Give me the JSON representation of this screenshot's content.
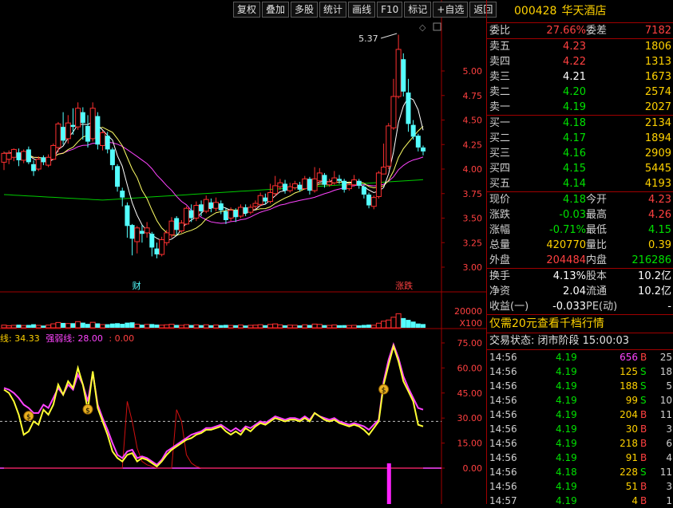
{
  "toolbar": {
    "buttons": [
      "复权",
      "叠加",
      "多股",
      "统计",
      "画线",
      "F10",
      "标记",
      "+自选",
      "返回"
    ]
  },
  "chart": {
    "price_axis": [
      "5.00",
      "4.75",
      "4.50",
      "4.25",
      "4.00",
      "3.75",
      "3.50",
      "3.25",
      "3.00"
    ],
    "vol_axis": [
      "20000",
      "X100"
    ],
    "ind_axis": [
      "75.00",
      "60.00",
      "45.00",
      "30.00",
      "15.00",
      "0.00"
    ],
    "high_label": "5.37",
    "marker_cai": "财",
    "marker_zhangdie": "涨跌",
    "indicator_name_1": "线: 34.33",
    "indicator_name_2": "强弱线: 28.00",
    "indicator_name_3": ": 0.00",
    "colors": {
      "up": "#ff3030",
      "down": "#54ffff",
      "ma5": "#ffffff",
      "ma10": "#ffff66",
      "ma20": "#ff44ff",
      "ma60": "#00cc00"
    },
    "candles": [
      [
        4.07,
        4.16,
        4.18,
        3.99
      ],
      [
        4.1,
        4.16,
        4.19,
        4.05
      ],
      [
        4.12,
        4.2,
        4.21,
        4.08
      ],
      [
        4.17,
        4.09,
        4.21,
        4.03
      ],
      [
        4.09,
        4.18,
        4.2,
        4.06
      ],
      [
        4.2,
        4.07,
        4.23,
        4.05
      ],
      [
        4.05,
        3.98,
        4.09,
        3.93
      ],
      [
        4.0,
        4.1,
        4.13,
        3.98
      ],
      [
        4.12,
        4.07,
        4.14,
        4.04
      ],
      [
        4.04,
        4.12,
        4.15,
        4.02
      ],
      [
        4.1,
        4.24,
        4.26,
        4.09
      ],
      [
        4.22,
        4.46,
        4.48,
        4.17
      ],
      [
        4.43,
        4.29,
        4.58,
        4.25
      ],
      [
        4.31,
        4.47,
        4.55,
        4.26
      ],
      [
        4.45,
        4.43,
        4.62,
        4.35
      ],
      [
        4.43,
        4.62,
        4.68,
        4.4
      ],
      [
        4.58,
        4.47,
        4.63,
        4.3
      ],
      [
        4.44,
        4.28,
        4.55,
        4.22
      ],
      [
        4.31,
        4.62,
        4.68,
        4.28
      ],
      [
        4.54,
        4.25,
        4.58,
        4.2
      ],
      [
        4.24,
        4.37,
        4.39,
        4.19
      ],
      [
        4.34,
        4.2,
        4.38,
        4.16
      ],
      [
        4.2,
        4.04,
        4.22,
        3.99
      ],
      [
        4.03,
        3.82,
        4.05,
        3.77
      ],
      [
        3.78,
        3.71,
        3.81,
        3.62
      ],
      [
        3.63,
        3.42,
        3.66,
        3.3
      ],
      [
        3.43,
        3.29,
        3.44,
        3.12
      ],
      [
        3.26,
        3.4,
        3.42,
        3.14
      ],
      [
        3.37,
        3.34,
        3.43,
        3.25
      ],
      [
        3.35,
        3.4,
        3.46,
        3.3
      ],
      [
        3.34,
        3.2,
        3.36,
        3.11
      ],
      [
        3.19,
        3.13,
        3.25,
        3.09
      ],
      [
        3.13,
        3.28,
        3.31,
        3.11
      ],
      [
        3.25,
        3.35,
        3.38,
        3.22
      ],
      [
        3.33,
        3.47,
        3.51,
        3.3
      ],
      [
        3.5,
        3.38,
        3.52,
        3.33
      ],
      [
        3.37,
        3.45,
        3.48,
        3.35
      ],
      [
        3.44,
        3.6,
        3.62,
        3.43
      ],
      [
        3.58,
        3.5,
        3.64,
        3.46
      ],
      [
        3.5,
        3.63,
        3.67,
        3.47
      ],
      [
        3.64,
        3.57,
        3.68,
        3.52
      ],
      [
        3.57,
        3.69,
        3.73,
        3.55
      ],
      [
        3.66,
        3.6,
        3.7,
        3.56
      ],
      [
        3.6,
        3.66,
        3.71,
        3.57
      ],
      [
        3.65,
        3.58,
        3.68,
        3.54
      ],
      [
        3.57,
        3.48,
        3.6,
        3.44
      ],
      [
        3.5,
        3.58,
        3.61,
        3.47
      ],
      [
        3.58,
        3.51,
        3.6,
        3.46
      ],
      [
        3.52,
        3.61,
        3.64,
        3.5
      ],
      [
        3.61,
        3.55,
        3.64,
        3.52
      ],
      [
        3.56,
        3.61,
        3.64,
        3.54
      ],
      [
        3.62,
        3.65,
        3.68,
        3.59
      ],
      [
        3.64,
        3.73,
        3.76,
        3.62
      ],
      [
        3.71,
        3.67,
        3.75,
        3.64
      ],
      [
        3.67,
        3.76,
        3.85,
        3.65
      ],
      [
        3.75,
        3.83,
        3.93,
        3.72
      ],
      [
        3.82,
        3.86,
        3.9,
        3.79
      ],
      [
        3.85,
        3.78,
        3.89,
        3.75
      ],
      [
        3.78,
        3.82,
        3.86,
        3.76
      ],
      [
        3.81,
        3.85,
        3.88,
        3.79
      ],
      [
        3.84,
        3.79,
        3.87,
        3.77
      ],
      [
        3.8,
        3.9,
        3.93,
        3.79
      ],
      [
        3.9,
        3.78,
        3.92,
        3.74
      ],
      [
        3.78,
        3.9,
        4.02,
        3.76
      ],
      [
        3.88,
        3.96,
        4.01,
        3.86
      ],
      [
        3.94,
        3.84,
        3.96,
        3.81
      ],
      [
        3.84,
        3.87,
        3.9,
        3.82
      ],
      [
        3.86,
        3.91,
        3.98,
        3.84
      ],
      [
        3.9,
        3.88,
        3.94,
        3.85
      ],
      [
        3.88,
        3.79,
        3.9,
        3.76
      ],
      [
        3.8,
        3.84,
        3.86,
        3.78
      ],
      [
        3.84,
        3.89,
        3.94,
        3.82
      ],
      [
        3.88,
        3.83,
        3.9,
        3.8
      ],
      [
        3.82,
        3.74,
        3.84,
        3.7
      ],
      [
        3.74,
        3.63,
        3.76,
        3.6
      ],
      [
        3.62,
        3.71,
        3.73,
        3.59
      ],
      [
        3.72,
        3.96,
        3.98,
        3.7
      ],
      [
        3.95,
        4.02,
        4.26,
        3.95
      ],
      [
        4.03,
        4.44,
        4.47,
        4.0
      ],
      [
        4.42,
        4.74,
        4.92,
        4.4
      ],
      [
        4.74,
        5.22,
        5.37,
        4.72
      ],
      [
        5.12,
        4.79,
        5.18,
        4.74
      ],
      [
        4.78,
        4.46,
        4.92,
        4.38
      ],
      [
        4.45,
        4.33,
        4.5,
        4.3
      ],
      [
        4.34,
        4.22,
        4.36,
        4.18
      ],
      [
        4.22,
        4.18,
        4.24,
        4.14
      ]
    ],
    "volumes": [
      30,
      24,
      28,
      35,
      26,
      32,
      40,
      27,
      25,
      30,
      45,
      60,
      55,
      48,
      52,
      70,
      58,
      44,
      62,
      50,
      36,
      40,
      48,
      52,
      45,
      58,
      62,
      40,
      35,
      38,
      42,
      36,
      30,
      34,
      40,
      32,
      28,
      35,
      31,
      33,
      30,
      34,
      29,
      31,
      30,
      33,
      27,
      29,
      31,
      26,
      28,
      30,
      35,
      29,
      38,
      44,
      33,
      28,
      30,
      29,
      27,
      34,
      31,
      42,
      38,
      30,
      27,
      32,
      29,
      30,
      26,
      28,
      27,
      32,
      36,
      29,
      52,
      75,
      88,
      120,
      160,
      110,
      90,
      70,
      48,
      42
    ],
    "ind_yellow": [
      47,
      45,
      40,
      32,
      20,
      22,
      28,
      26,
      35,
      32,
      38,
      50,
      44,
      52,
      48,
      60,
      50,
      35,
      58,
      36,
      28,
      20,
      10,
      6,
      4,
      8,
      9,
      4,
      6,
      5,
      3,
      1,
      4,
      8,
      11,
      13,
      15,
      17,
      18,
      20,
      21,
      23,
      23,
      24,
      25,
      22,
      20,
      22,
      20,
      24,
      22,
      25,
      27,
      26,
      28,
      30,
      29,
      28,
      29,
      29,
      28,
      30,
      28,
      33,
      31,
      29,
      28,
      29,
      27,
      26,
      25,
      26,
      25,
      23,
      20,
      24,
      28,
      50,
      62,
      73,
      64,
      52,
      46,
      40,
      26,
      25
    ],
    "ind_magenta": [
      48,
      47,
      45,
      42,
      38,
      36,
      33,
      33,
      38,
      36,
      42,
      48,
      44,
      50,
      47,
      56,
      50,
      40,
      57,
      38,
      30,
      23,
      15,
      8,
      6,
      10,
      11,
      6,
      7,
      6,
      4,
      2,
      5,
      10,
      12,
      14,
      16,
      18,
      20,
      21,
      22,
      24,
      24,
      25,
      26,
      24,
      22,
      24,
      22,
      25,
      24,
      26,
      28,
      27,
      29,
      31,
      30,
      29,
      30,
      30,
      29,
      31,
      29,
      33,
      31,
      30,
      29,
      30,
      28,
      27,
      26,
      27,
      26,
      25,
      23,
      26,
      29,
      52,
      65,
      74,
      66,
      55,
      48,
      42,
      36,
      35
    ],
    "ind_red": [
      0,
      0,
      0,
      0,
      0,
      0,
      0,
      0,
      0,
      0,
      0,
      0,
      0,
      0,
      0,
      0,
      0,
      0,
      0,
      0,
      0,
      0,
      0,
      0,
      0,
      40,
      28,
      12,
      4,
      2,
      1,
      0,
      0,
      0,
      0,
      35,
      28,
      8,
      3,
      1,
      0,
      0,
      0,
      0,
      0,
      0,
      0,
      0,
      0,
      0,
      0,
      0,
      0,
      0,
      0,
      0,
      0,
      0,
      0,
      0,
      0,
      0,
      0,
      0,
      0,
      0,
      0,
      0,
      0,
      0,
      0,
      0,
      0,
      0,
      0,
      0,
      0,
      0,
      0,
      0,
      0,
      0,
      0,
      0,
      0,
      0
    ]
  },
  "quote": {
    "code": "000428",
    "name": "华天酒店",
    "weibi_label": "委比",
    "weibi_value": "27.66%",
    "weicha_label": "委差",
    "weicha_value": "7182",
    "sells": [
      {
        "label": "卖五",
        "price": "4.23",
        "vol": "1806",
        "color": "red"
      },
      {
        "label": "卖四",
        "price": "4.22",
        "vol": "1313",
        "color": "red"
      },
      {
        "label": "卖三",
        "price": "4.21",
        "vol": "1673",
        "color": "white"
      },
      {
        "label": "卖二",
        "price": "4.20",
        "vol": "2574",
        "color": "green"
      },
      {
        "label": "卖一",
        "price": "4.19",
        "vol": "2027",
        "color": "green"
      }
    ],
    "buys": [
      {
        "label": "买一",
        "price": "4.18",
        "vol": "2134",
        "color": "green"
      },
      {
        "label": "买二",
        "price": "4.17",
        "vol": "1894",
        "color": "green"
      },
      {
        "label": "买三",
        "price": "4.16",
        "vol": "2909",
        "color": "green"
      },
      {
        "label": "买四",
        "price": "4.15",
        "vol": "5445",
        "color": "green"
      },
      {
        "label": "买五",
        "price": "4.14",
        "vol": "4193",
        "color": "green"
      }
    ],
    "stats": [
      {
        "l1": "现价",
        "v1": "4.18",
        "c1": "green",
        "l2": "今开",
        "v2": "4.23",
        "c2": "red"
      },
      {
        "l1": "涨跌",
        "v1": "-0.03",
        "c1": "green",
        "l2": "最高",
        "v2": "4.26",
        "c2": "red"
      },
      {
        "l1": "涨幅",
        "v1": "-0.71%",
        "c1": "green",
        "l2": "最低",
        "v2": "4.15",
        "c2": "green"
      },
      {
        "l1": "总量",
        "v1": "420770",
        "c1": "yellow",
        "l2": "量比",
        "v2": "0.39",
        "c2": "yellow"
      },
      {
        "l1": "外盘",
        "v1": "204484",
        "c1": "red",
        "l2": "内盘",
        "v2": "216286",
        "c2": "green"
      }
    ],
    "fund": [
      {
        "l1": "换手",
        "v1": "4.13%",
        "l2": "股本",
        "v2": "10.2亿"
      },
      {
        "l1": "净资",
        "v1": "2.04",
        "l2": "流通",
        "v2": "10.2亿"
      },
      {
        "l1": "收益(一)",
        "v1": "-0.033",
        "l2": "PE(动)",
        "v2": "-"
      }
    ],
    "notice": "仅需20元查看千档行情",
    "trade_state": "交易状态: 闭市阶段 15:00:03",
    "ticks": [
      {
        "t": "14:56",
        "p": "4.19",
        "v": "656",
        "vc": "#ff44ff",
        "f": "B",
        "n": "25"
      },
      {
        "t": "14:56",
        "p": "4.19",
        "v": "125",
        "vc": "#ffd200",
        "f": "S",
        "n": "18"
      },
      {
        "t": "14:56",
        "p": "4.19",
        "v": "188",
        "vc": "#ffd200",
        "f": "S",
        "n": "5"
      },
      {
        "t": "14:56",
        "p": "4.19",
        "v": "99",
        "vc": "#ffd200",
        "f": "S",
        "n": "10"
      },
      {
        "t": "14:56",
        "p": "4.19",
        "v": "204",
        "vc": "#ffd200",
        "f": "B",
        "n": "11"
      },
      {
        "t": "14:56",
        "p": "4.19",
        "v": "30",
        "vc": "#ffd200",
        "f": "B",
        "n": "3"
      },
      {
        "t": "14:56",
        "p": "4.19",
        "v": "218",
        "vc": "#ffd200",
        "f": "B",
        "n": "6"
      },
      {
        "t": "14:56",
        "p": "4.19",
        "v": "91",
        "vc": "#ffd200",
        "f": "B",
        "n": "4"
      },
      {
        "t": "14:56",
        "p": "4.18",
        "v": "228",
        "vc": "#ffd200",
        "f": "S",
        "n": "11"
      },
      {
        "t": "14:56",
        "p": "4.19",
        "v": "51",
        "vc": "#ffd200",
        "f": "B",
        "n": "3"
      },
      {
        "t": "14:57",
        "p": "4.19",
        "v": "4",
        "vc": "#ffd200",
        "f": "B",
        "n": "1"
      }
    ]
  }
}
